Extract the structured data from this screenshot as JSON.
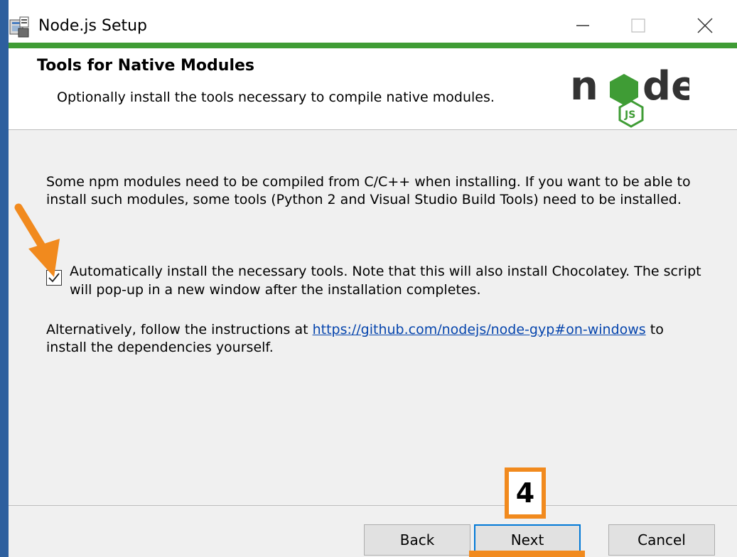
{
  "window": {
    "title": "Node.js Setup",
    "controls": [
      "minimize",
      "maximize",
      "close"
    ]
  },
  "header": {
    "title": "Tools for Native Modules",
    "subtitle": "Optionally install the tools necessary to compile native modules.",
    "logo_text": "node"
  },
  "content": {
    "intro_line1": "Some npm modules need to be compiled from C/C++ when installing. If you want to be able to",
    "intro_line2": "install such modules, some tools (Python 2 and Visual Studio Build Tools) need to be installed.",
    "checkbox": {
      "checked": true,
      "label_line1": "Automatically install the necessary tools. Note that this will also install Chocolatey. The script",
      "label_line2": "will pop-up in a new window after the installation completes."
    },
    "alt_prefix": "Alternatively, follow the instructions at ",
    "alt_link": "https://github.com/nodejs/node-gyp#on-windows",
    "alt_suffix": " to",
    "alt_line2": "install the dependencies yourself."
  },
  "buttons": {
    "back": "Back",
    "next": "Next",
    "cancel": "Cancel"
  },
  "annotation": {
    "step_number": "4",
    "color": "#f18a1e"
  },
  "colors": {
    "accent_green": "#3f9c35",
    "link": "#0645ad",
    "default_button_border": "#0078d7"
  }
}
